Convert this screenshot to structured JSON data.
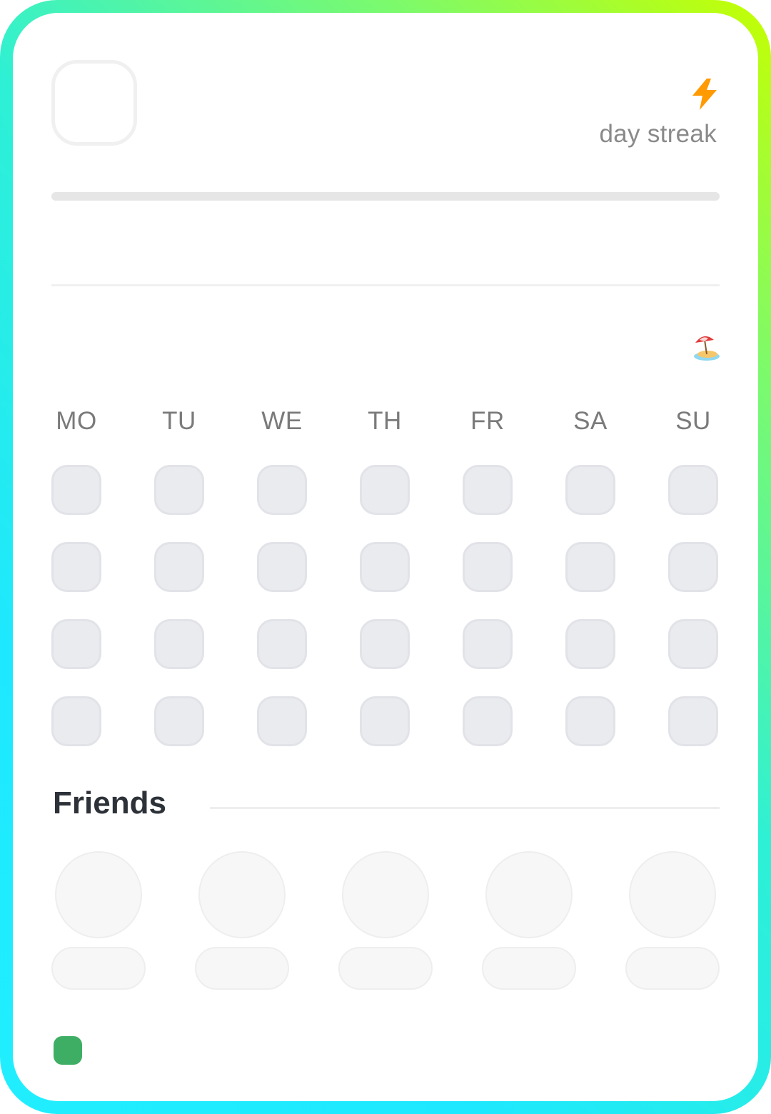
{
  "header": {
    "streak_label": "day streak",
    "streak_icon": "lightning-bolt-icon",
    "streak_icon_color": "#ff9a00",
    "progress": 0
  },
  "calendar": {
    "status_icon": "beach-umbrella-icon",
    "weekdays": [
      "MO",
      "TU",
      "WE",
      "TH",
      "FR",
      "SA",
      "SU"
    ],
    "weeks": 4
  },
  "friends": {
    "title": "Friends",
    "placeholder_count": 5
  },
  "colors": {
    "frame_gradient": [
      "#c6ff00",
      "#1ee8ff"
    ],
    "status_dot": "#3fae65",
    "day_cell": "#eaebef",
    "title_text": "#2d3138"
  }
}
